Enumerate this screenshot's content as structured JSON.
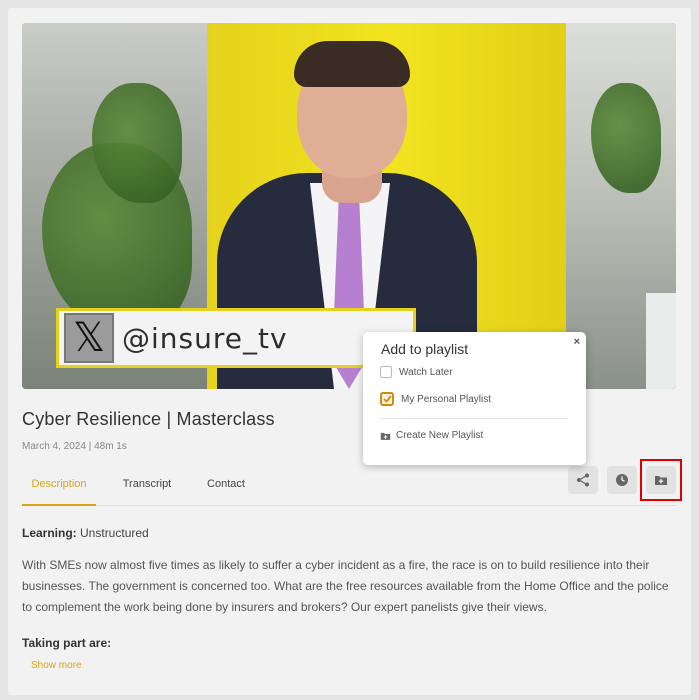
{
  "video": {
    "handle": "@insure_tv",
    "x_logo": "𝕏"
  },
  "title": "Cyber Resilience | Masterclass",
  "meta": "March 4, 2024 | 48m 1s",
  "tabs": [
    {
      "label": "Description",
      "active": true
    },
    {
      "label": "Transcript",
      "active": false
    },
    {
      "label": "Contact",
      "active": false
    }
  ],
  "actions": {
    "share_icon": "share-icon",
    "clock_icon": "clock-icon",
    "folder_icon": "folder-plus-icon"
  },
  "content": {
    "learning_label": "Learning:",
    "learning_value": "Unstructured",
    "description": "With SMEs now almost five times as likely to suffer a cyber incident as a fire, the race is on to build resilience into their businesses. The government is concerned too. What are the free resources available from the Home Office and the police to complement the work being done by insurers and brokers? Our expert panelists give their views.",
    "taking_part": "Taking part are:",
    "show_more": "Show more"
  },
  "popup": {
    "title": "Add to playlist",
    "close": "×",
    "playlists": [
      {
        "label": "Watch Later",
        "checked": false
      },
      {
        "label": "My Personal Playlist",
        "checked": true
      }
    ],
    "create_label": "Create New Playlist"
  },
  "colors": {
    "accent": "#d6a51b",
    "highlight": "#e00000",
    "checkbox_checked": "#d18a10"
  }
}
